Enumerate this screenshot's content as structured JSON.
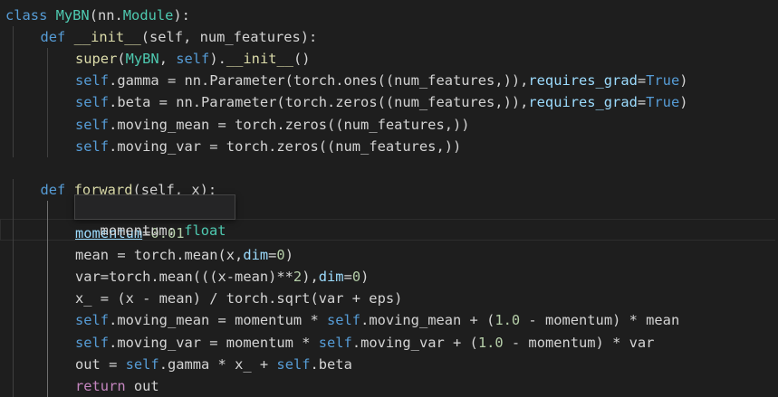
{
  "editor": {
    "lines": [
      [
        [
          "kw",
          "class"
        ],
        [
          "plain",
          " "
        ],
        [
          "cls",
          "MyBN"
        ],
        [
          "plain",
          "(nn."
        ],
        [
          "cls",
          "Module"
        ],
        [
          "plain",
          "):"
        ]
      ],
      [
        [
          "kw",
          "def"
        ],
        [
          "plain",
          " "
        ],
        [
          "fn",
          "__init__"
        ],
        [
          "plain",
          "(self, num_features):"
        ]
      ],
      [
        [
          "fn",
          "super"
        ],
        [
          "plain",
          "("
        ],
        [
          "cls",
          "MyBN"
        ],
        [
          "plain",
          ", "
        ],
        [
          "self",
          "self"
        ],
        [
          "plain",
          ")."
        ],
        [
          "fn",
          "__init__"
        ],
        [
          "plain",
          "()"
        ]
      ],
      [
        [
          "self",
          "self"
        ],
        [
          "plain",
          ".gamma = nn.Parameter(torch.ones((num_features,)),"
        ],
        [
          "param",
          "requires_grad"
        ],
        [
          "plain",
          "="
        ],
        [
          "kw",
          "True"
        ],
        [
          "plain",
          ")"
        ]
      ],
      [
        [
          "self",
          "self"
        ],
        [
          "plain",
          ".beta = nn.Parameter(torch.zeros((num_features,)),"
        ],
        [
          "param",
          "requires_grad"
        ],
        [
          "plain",
          "="
        ],
        [
          "kw",
          "True"
        ],
        [
          "plain",
          ")"
        ]
      ],
      [
        [
          "self",
          "self"
        ],
        [
          "plain",
          ".moving_mean = torch.zeros((num_features,))"
        ]
      ],
      [
        [
          "self",
          "self"
        ],
        [
          "plain",
          ".moving_var = torch.zeros((num_features,))"
        ]
      ],
      [],
      [
        [
          "kw",
          "def"
        ],
        [
          "plain",
          " "
        ],
        [
          "fn",
          "forward"
        ],
        [
          "plain",
          "(self, x):"
        ]
      ],
      [],
      [
        [
          "link",
          "momentum"
        ],
        [
          "plain",
          "="
        ],
        [
          "num",
          "0.01"
        ]
      ],
      [
        [
          "plain",
          "mean = torch.mean(x,"
        ],
        [
          "param",
          "dim"
        ],
        [
          "plain",
          "="
        ],
        [
          "num",
          "0"
        ],
        [
          "plain",
          ")"
        ]
      ],
      [
        [
          "plain",
          "var=torch.mean(((x-mean)**"
        ],
        [
          "num",
          "2"
        ],
        [
          "plain",
          "),"
        ],
        [
          "param",
          "dim"
        ],
        [
          "plain",
          "="
        ],
        [
          "num",
          "0"
        ],
        [
          "plain",
          ")"
        ]
      ],
      [
        [
          "plain",
          "x_ = (x - mean) / torch.sqrt(var + eps)"
        ]
      ],
      [
        [
          "self",
          "self"
        ],
        [
          "plain",
          ".moving_mean = momentum * "
        ],
        [
          "self",
          "self"
        ],
        [
          "plain",
          ".moving_mean + ("
        ],
        [
          "num",
          "1.0"
        ],
        [
          "plain",
          " - momentum) * mean"
        ]
      ],
      [
        [
          "self",
          "self"
        ],
        [
          "plain",
          ".moving_var = momentum * "
        ],
        [
          "self",
          "self"
        ],
        [
          "plain",
          ".moving_var + ("
        ],
        [
          "num",
          "1.0"
        ],
        [
          "plain",
          " - momentum) * var"
        ]
      ],
      [
        [
          "plain",
          "out = "
        ],
        [
          "self",
          "self"
        ],
        [
          "plain",
          ".gamma * x_ + "
        ],
        [
          "self",
          "self"
        ],
        [
          "plain",
          ".beta"
        ]
      ],
      [
        [
          "ret",
          "return"
        ],
        [
          "plain",
          " out"
        ]
      ]
    ],
    "indents": [
      0,
      1,
      2,
      2,
      2,
      2,
      2,
      0,
      1,
      2,
      2,
      2,
      2,
      2,
      2,
      2,
      2,
      2
    ]
  },
  "tooltip": {
    "name": "momentum: ",
    "type": "float"
  }
}
